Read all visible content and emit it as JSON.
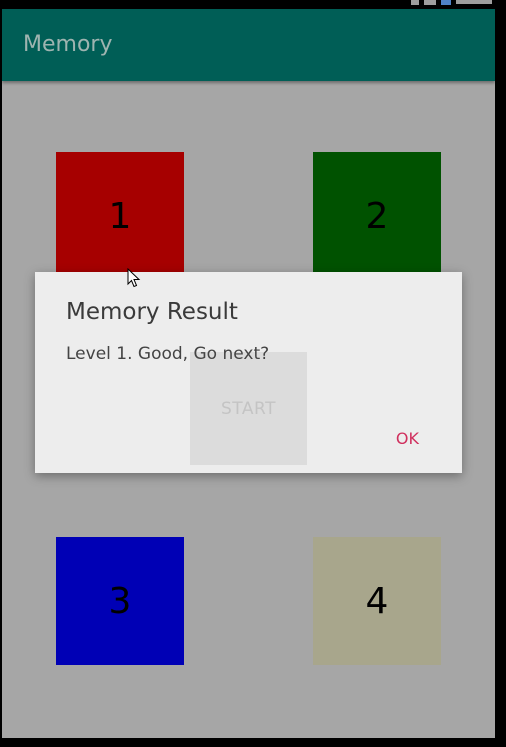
{
  "app": {
    "title": "Memory"
  },
  "tiles": [
    {
      "label": "1",
      "color": "#a60000"
    },
    {
      "label": "2",
      "color": "#005200"
    },
    {
      "label": "3",
      "color": "#0000b5"
    },
    {
      "label": "4",
      "color": "#a8a68c"
    }
  ],
  "start_button": {
    "label": "START"
  },
  "dialog": {
    "title": "Memory Result",
    "message": "Level 1. Good, Go next?",
    "ok_label": "OK",
    "accent_color": "#d0305e"
  },
  "theme": {
    "app_bar_color": "#005e56",
    "background": "#a6a6a6"
  }
}
